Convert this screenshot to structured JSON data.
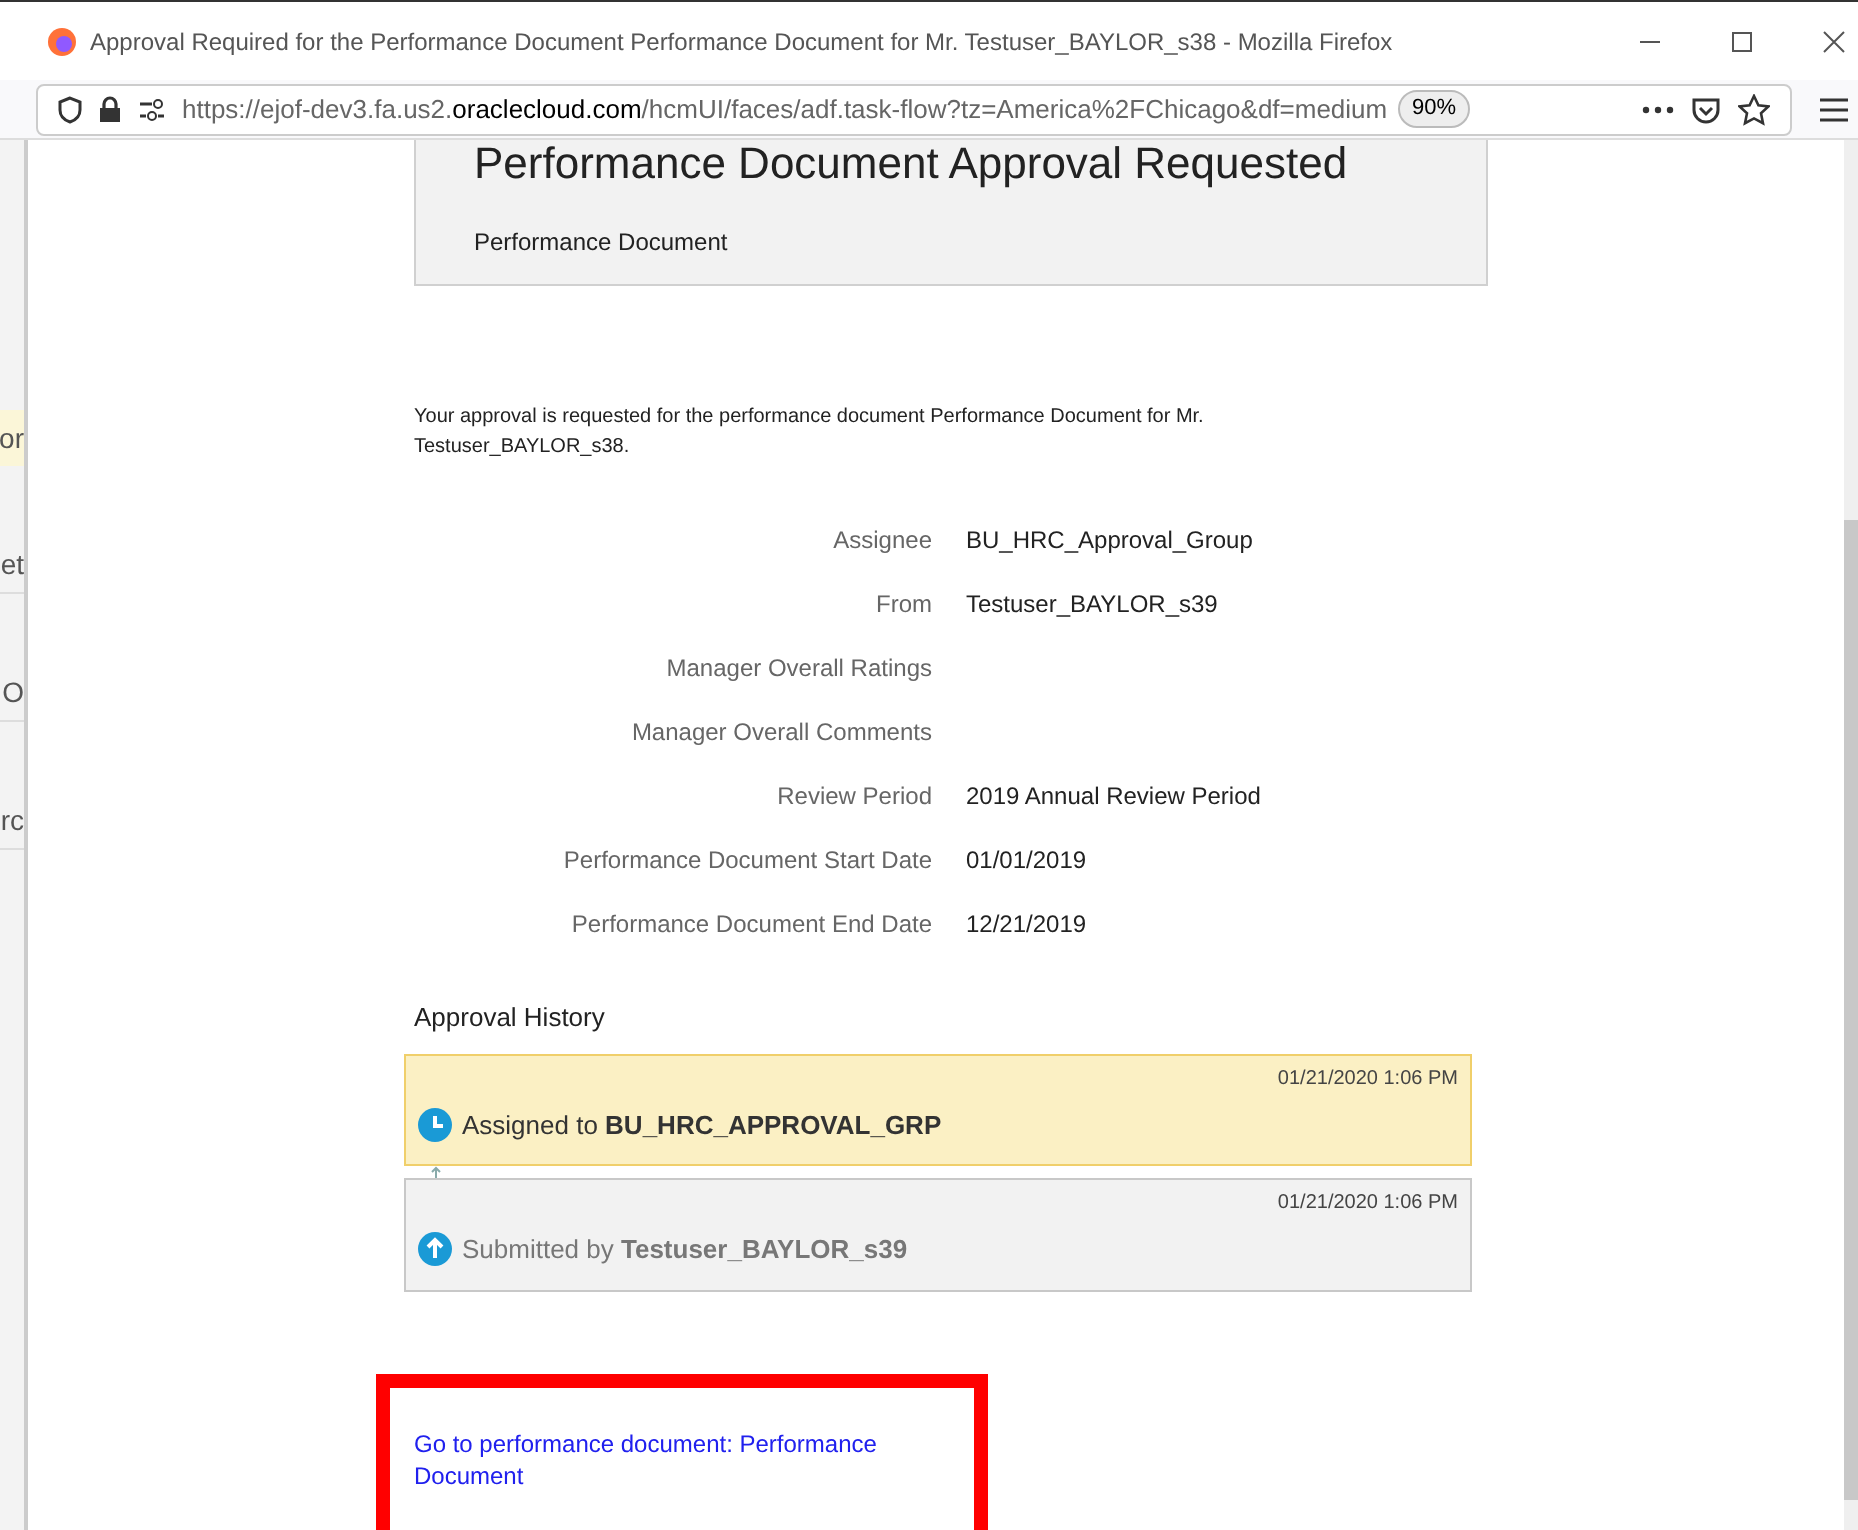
{
  "window": {
    "title": "Approval Required for the Performance Document Performance Document for Mr. Testuser_BAYLOR_s38 - Mozilla Firefox"
  },
  "address_bar": {
    "url_prefix": "https://ejof-dev3.fa.us2.",
    "url_domain": "oraclecloud.com",
    "url_rest": "/hcmUI/faces/adf.task-flow?tz=America%2FChicago&df=medium",
    "zoom": "90%"
  },
  "background_window": {
    "fragments": [
      {
        "text": "or",
        "highlighted": true
      },
      {
        "text": "et",
        "highlighted": false
      },
      {
        "text": "O",
        "highlighted": false
      },
      {
        "text": "rc",
        "highlighted": false
      }
    ]
  },
  "header": {
    "title": "Performance Document Approval Requested",
    "subtitle": "Performance Document"
  },
  "intro": "Your approval is requested for the performance document Performance Document for Mr. Testuser_BAYLOR_s38.",
  "fields": [
    {
      "label": "Assignee",
      "value": "BU_HRC_Approval_Group"
    },
    {
      "label": "From",
      "value": "Testuser_BAYLOR_s39"
    },
    {
      "label": "Manager Overall Ratings"
    },
    {
      "label": "Manager Overall Comments"
    },
    {
      "label": "Review Period",
      "value": "2019 Annual Review Period"
    },
    {
      "label": "Performance Document Start Date",
      "value": "01/01/2019"
    },
    {
      "label": "Performance Document End Date",
      "value": "12/21/2019"
    }
  ],
  "approval_history": {
    "title": "Approval History",
    "entries": [
      {
        "kind": "assigned",
        "time": "01/21/2020 1:06 PM",
        "text": "Assigned to **BU_HRC_APPROVAL_GRP**",
        "selected": true
      },
      {
        "kind": "submitted",
        "time": "01/21/2020 1:06 PM",
        "text": "Submitted by **Testuser_BAYLOR_s39**",
        "selected": false
      }
    ]
  },
  "link": "Go to performance document: Performance Document"
}
